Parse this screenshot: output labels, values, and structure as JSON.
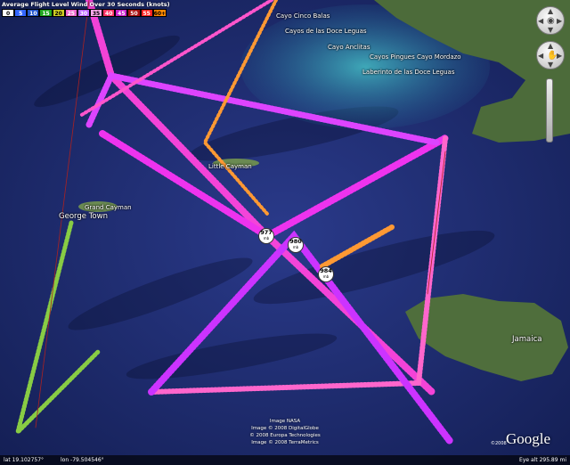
{
  "legend": {
    "title": "Average Flight Level Wind Over 30 Seconds (knots)",
    "bins": [
      {
        "label": "0",
        "color": "#ffffff",
        "text": "#000000"
      },
      {
        "label": "5",
        "color": "#3366ff",
        "text": "#ffffff"
      },
      {
        "label": "10",
        "color": "#2255cc",
        "text": "#ffffff"
      },
      {
        "label": "15",
        "color": "#22aa22",
        "text": "#ffffff"
      },
      {
        "label": "20",
        "color": "#cccc22",
        "text": "#000000"
      },
      {
        "label": "25",
        "color": "#ee66cc",
        "text": "#ffffff"
      },
      {
        "label": "30",
        "color": "#bb66ff",
        "text": "#ffffff"
      },
      {
        "label": "35",
        "color": "#ffaaee",
        "text": "#000000"
      },
      {
        "label": "40",
        "color": "#ff3366",
        "text": "#ffffff"
      },
      {
        "label": "45",
        "color": "#cc22cc",
        "text": "#ffffff"
      },
      {
        "label": "50",
        "color": "#aa1111",
        "text": "#ffffff"
      },
      {
        "label": "55",
        "color": "#ff2222",
        "text": "#ffffff"
      },
      {
        "label": "60+",
        "color": "#ff8800",
        "text": "#000000"
      }
    ]
  },
  "places": [
    {
      "label": "Cayo Cinco Balas"
    },
    {
      "label": "Cayos de las Doce Leguas"
    },
    {
      "label": "Cayo Anclitas"
    },
    {
      "label": "Cayos Pingues Cayo Mordazo"
    },
    {
      "label": "Laberinto de las Doce Leguas"
    },
    {
      "label": "Little Cayman"
    },
    {
      "label": "Grand Cayman"
    },
    {
      "label": "George Town"
    },
    {
      "label": "Jamaica"
    }
  ],
  "pressure_markers": [
    {
      "value": "977",
      "unit": "mb"
    },
    {
      "value": "980",
      "unit": "mb"
    },
    {
      "value": "984",
      "unit": "mb"
    }
  ],
  "credits": [
    "Image NASA",
    "Image © 2008 DigitalGlobe",
    "© 2008 Europa Technologies",
    "Image © 2008 TerraMetrics"
  ],
  "brand": {
    "logo": "Google",
    "year": "©2008"
  },
  "status": {
    "lat": "lat  19.102757°",
    "lon": "lon  -79.504546°",
    "eye_alt": "Eye alt   295.89 mi"
  },
  "nav": {
    "look_icon": "eye-icon",
    "move_icon": "hand-icon"
  },
  "colors": {
    "ocean": "#1a2a6a",
    "land": "#4a6a3a",
    "track_magenta": "#ff44dd",
    "track_orange": "#ff9933",
    "track_red": "#aa2222"
  }
}
